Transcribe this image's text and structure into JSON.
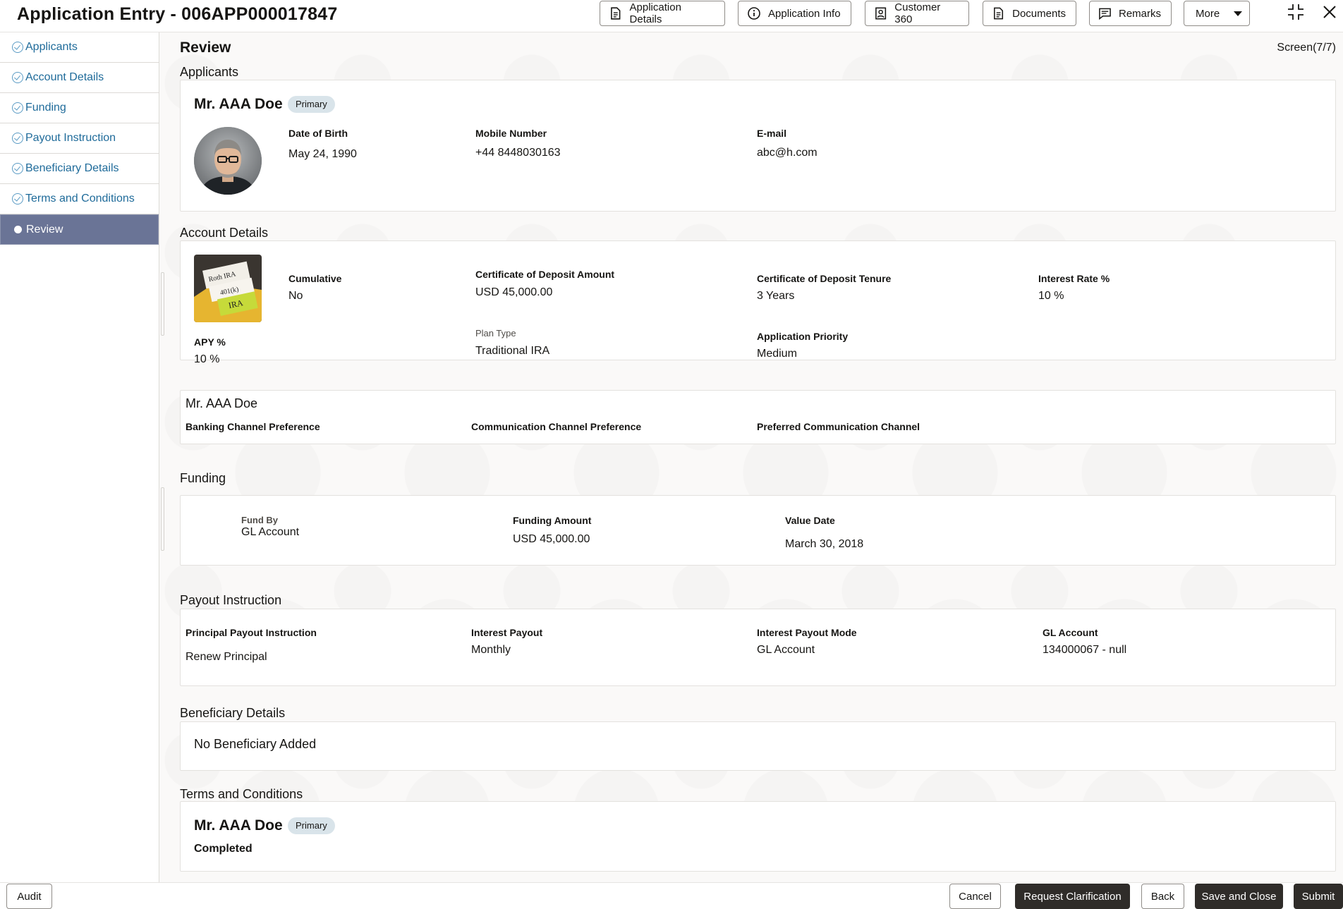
{
  "header": {
    "title": "Application Entry - 006APP000017847",
    "buttons": {
      "application_details": "Application Details",
      "application_info": "Application Info",
      "customer_360": "Customer 360",
      "documents": "Documents",
      "remarks": "Remarks",
      "more": "More"
    },
    "icons": [
      "document-icon",
      "info-icon",
      "customer-icon",
      "documents-icon",
      "remarks-icon",
      "chevron-down-icon",
      "collapse-icon",
      "close-icon"
    ]
  },
  "sidebar": {
    "items": [
      {
        "label": "Applicants",
        "state": "completed"
      },
      {
        "label": "Account Details",
        "state": "completed"
      },
      {
        "label": "Funding",
        "state": "completed"
      },
      {
        "label": "Payout Instruction",
        "state": "completed"
      },
      {
        "label": "Beneficiary Details",
        "state": "completed"
      },
      {
        "label": "Terms and Conditions",
        "state": "completed"
      },
      {
        "label": "Review",
        "state": "active"
      }
    ]
  },
  "main": {
    "title": "Review",
    "screen_count": "Screen(7/7)",
    "applicants": {
      "section_title": "Applicants",
      "name": "Mr. AAA Doe",
      "badge": "Primary",
      "dob_label": "Date of Birth",
      "dob": "May 24, 1990",
      "mobile_label": "Mobile Number",
      "mobile": "+44 8448030163",
      "email_label": "E-mail",
      "email": "abc@h.com"
    },
    "account_details": {
      "section_title": "Account Details",
      "image_labels": [
        "Roth IRA",
        "401(k)",
        "IRA"
      ],
      "cumulative_label": "Cumulative",
      "cumulative": "No",
      "cd_amount_label": "Certificate of Deposit Amount",
      "cd_amount": "USD 45,000.00",
      "cd_tenure_label": "Certificate of Deposit Tenure",
      "cd_tenure": "3 Years",
      "interest_rate_label": "Interest Rate %",
      "interest_rate": "10 %",
      "apy_label": "APY %",
      "apy": "10 %",
      "plan_type_label": "Plan Type",
      "plan_type": "Traditional IRA",
      "priority_label": "Application Priority",
      "priority": "Medium"
    },
    "preferences": {
      "name": "Mr. AAA Doe",
      "banking_label": "Banking Channel Preference",
      "communication_label": "Communication Channel Preference",
      "preferred_label": "Preferred Communication Channel"
    },
    "funding": {
      "section_title": "Funding",
      "fund_by_label": "Fund By",
      "fund_by": "GL Account",
      "amount_label": "Funding Amount",
      "amount": "USD 45,000.00",
      "value_date_label": "Value Date",
      "value_date": "March 30, 2018"
    },
    "payout": {
      "section_title": "Payout Instruction",
      "principal_label": "Principal Payout Instruction",
      "principal": "Renew Principal",
      "interest_payout_label": "Interest Payout",
      "interest_payout": "Monthly",
      "interest_mode_label": "Interest Payout Mode",
      "interest_mode": "GL Account",
      "gl_account_label": "GL Account",
      "gl_account": "134000067 - null"
    },
    "beneficiary": {
      "section_title": "Beneficiary Details",
      "empty_text": "No Beneficiary Added"
    },
    "terms": {
      "section_title": "Terms and Conditions",
      "name": "Mr. AAA Doe",
      "badge": "Primary",
      "status": "Completed"
    }
  },
  "footer": {
    "audit": "Audit",
    "cancel": "Cancel",
    "request_clarification": "Request Clarification",
    "back": "Back",
    "save_and_close": "Save and Close",
    "submit": "Submit"
  }
}
